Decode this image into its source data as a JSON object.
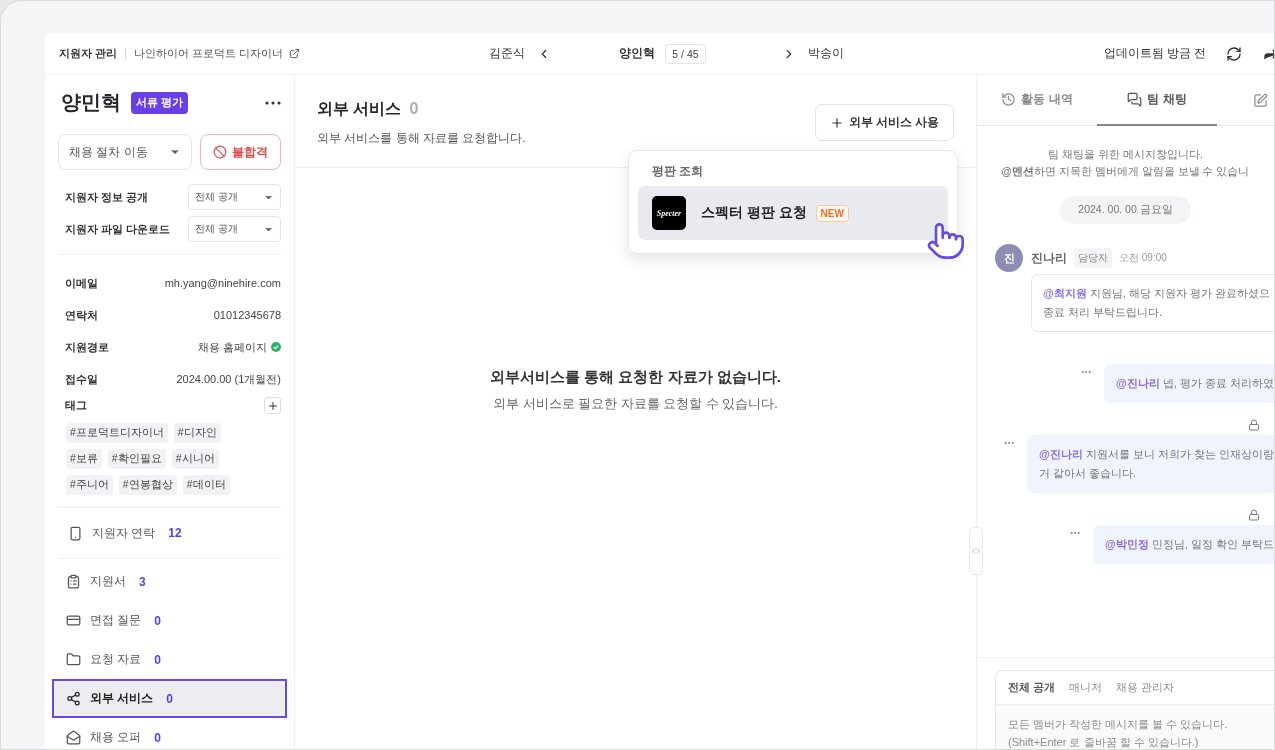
{
  "breadcrumb": {
    "section": "지원자 관리",
    "job": "나인하이어 프로덕트 디자이너"
  },
  "navigator": {
    "prev": "김준식",
    "current": "양인혁",
    "position": "5 / 45",
    "next": "박송이"
  },
  "update_status": "업데이트됨 방금 전",
  "candidate": {
    "name": "양민혁",
    "stage": "서류 평가"
  },
  "stage_select": {
    "value": "채용 절차 이동"
  },
  "reject_button": "불합격",
  "settings": [
    {
      "label": "지원자 정보 공개",
      "value": "전체 공개"
    },
    {
      "label": "지원자 파일 다운로드",
      "value": "전체 공개"
    }
  ],
  "info": [
    {
      "label": "이메일",
      "value": "mh.yang@ninehire.com",
      "verified": false
    },
    {
      "label": "연락처",
      "value": "01012345678",
      "verified": false
    },
    {
      "label": "지원경로",
      "value": "채용 홈페이지",
      "verified": true
    },
    {
      "label": "접수일",
      "value": "2024.00.00 (1개월전)",
      "verified": false
    }
  ],
  "tags": {
    "label": "태그",
    "items": [
      "#프로덕트디자이너",
      "#디자인",
      "#보류",
      "#확인필요",
      "#시니어",
      "#주니어",
      "#연봉협상",
      "#데이터"
    ]
  },
  "contact": {
    "label": "지원자 연락",
    "count": "12"
  },
  "sections": [
    {
      "kind": "document",
      "label": "지원서",
      "count": "3",
      "selected": false
    },
    {
      "kind": "interview",
      "label": "면접 질문",
      "count": "0",
      "selected": false
    },
    {
      "kind": "folder",
      "label": "요청 자료",
      "count": "0",
      "selected": false
    },
    {
      "kind": "share",
      "label": "외부 서비스",
      "count": "0",
      "selected": true
    },
    {
      "kind": "offer",
      "label": "채용 오퍼",
      "count": "0",
      "selected": false
    }
  ],
  "main": {
    "title": "외부 서비스",
    "count": "0",
    "subtitle": "외부 서비스를 통해 자료를 요청합니다.",
    "add_button": "외부 서비스 사용",
    "empty_title": "외부서비스를 통해 요청한 자료가 없습니다.",
    "empty_text": "외부 서비스로 필요한 자료를 요청할 수 있습니다."
  },
  "dropdown": {
    "group": "평판 조회",
    "items": [
      {
        "logo_text": "Specter",
        "label": "스펙터 평판 요청",
        "badge": "NEW",
        "highlighted": true
      }
    ]
  },
  "chat_panel": {
    "tabs": [
      {
        "kind": "history",
        "label": "활동 내역",
        "selected": false
      },
      {
        "kind": "chat",
        "label": "팀 채팅",
        "selected": true
      },
      {
        "kind": "note",
        "selected": false
      }
    ],
    "notice": [
      "팀 채팅을 위한 메시지창입니다.",
      "**@멘션**하면 지목한 멤버에게 알림을 보낼 수 있습니"
    ],
    "date": "2024. 00. 00 금요일",
    "messages": [
      {
        "kind": "received",
        "initial": "진",
        "author": "진나리",
        "role": "담당자",
        "time": "오전 09:00",
        "mention": "@최지원",
        "lines": [
          " 지원님, 해당 지원자 평가 완료하셨으",
          "종료 처리 부탁드립니다."
        ]
      },
      {
        "kind": "sent",
        "locked": false,
        "mention": "@진나리",
        "lines": [
          " 넵, 평가 종료 처리하였"
        ]
      },
      {
        "kind": "sent",
        "locked": true,
        "mention": "@진나리",
        "lines": [
          " 지원서를 보니 저희가 찾는 인재상이랑",
          "거 같아서 좋습니다."
        ]
      },
      {
        "kind": "sent",
        "locked": true,
        "mention": "@박민정",
        "lines": [
          " 민정님, 일정 확인 부탁드"
        ]
      }
    ],
    "composer": {
      "tabs": [
        {
          "label": "전체 공개",
          "selected": true
        },
        {
          "label": "매니저",
          "selected": false
        },
        {
          "label": "채용 관리자",
          "selected": false
        }
      ],
      "placeholder": "모든 멤버가 작성한 메시지를 볼 수 있습니다.\n(Shift+Enter 로 줄바꿈 할 수 있습니다.)"
    }
  }
}
